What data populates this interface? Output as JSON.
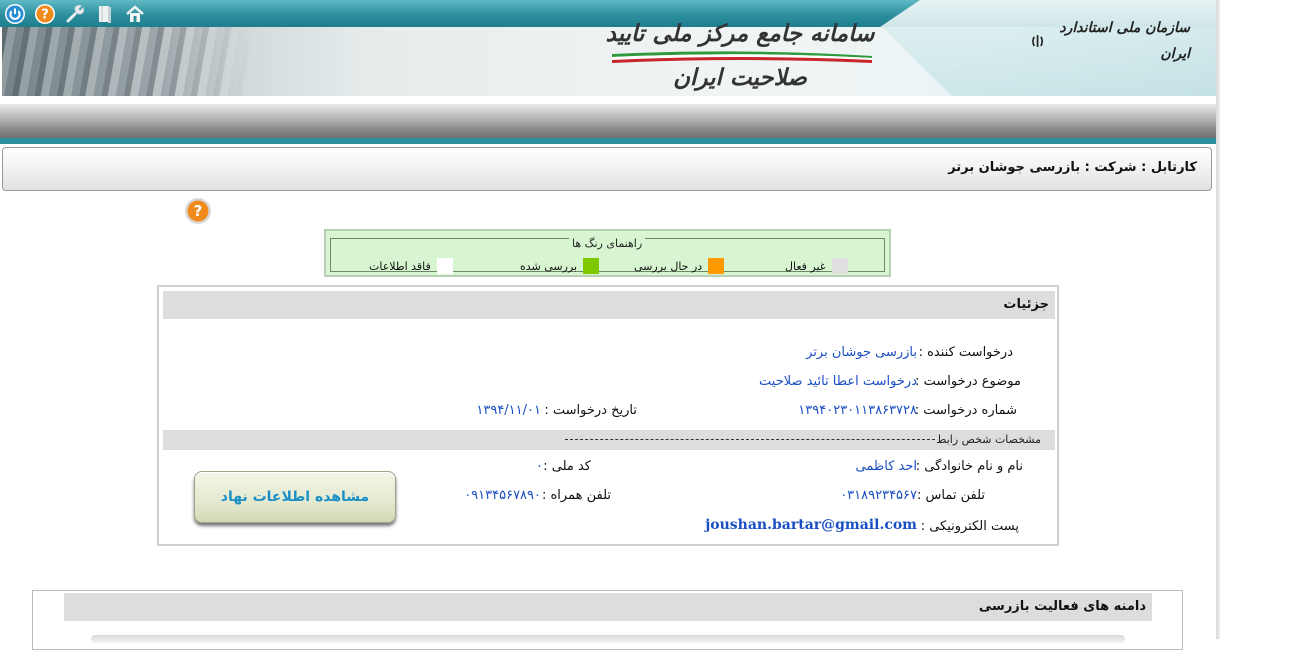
{
  "header": {
    "system_title": "سامانه جامع مرکز ملی تایید صلاحیت ایران",
    "organization": "سازمان ملی استاندارد ایران",
    "icons": [
      "power-icon",
      "help-icon",
      "wrench-icon",
      "book-icon",
      "home-icon"
    ]
  },
  "breadcrumb": {
    "text": "کارتابل : شرکت : بازرسی جوشان برتر"
  },
  "legend": {
    "title": "راهنمای رنگ ها",
    "items": [
      {
        "label": "غیر فعال",
        "color": "#e0e0e0"
      },
      {
        "label": "در حال بررسی",
        "color": "#ff9900"
      },
      {
        "label": "بررسی شده",
        "color": "#7ec800"
      },
      {
        "label": "فاقد اطلاعات",
        "color": "#ffffff"
      }
    ]
  },
  "details": {
    "title": "جزئیات",
    "requester_label": "درخواست کننده :",
    "requester_value": "بازرسی جوشان برتر",
    "subject_label": "موضوع درخواست :",
    "subject_value": "درخواست اعطا تائید صلاحیت",
    "request_number_label": "شماره درخواست :",
    "request_number_value": "۱۳۹۴۰۲۳۰۱۱۳۸۶۳۷۲۸",
    "request_date_label": "تاریخ درخواست :",
    "request_date_value": "۱۳۹۴/۱۱/۰۱",
    "contact_section_title": "مشخصات شخص رابط",
    "name_label": "نام و نام خانوادگی :",
    "name_value": "احد کاظمی",
    "national_code_label": "کد ملی :",
    "national_code_value": "۰",
    "phone_label": "تلفن تماس :",
    "phone_value": "۰۳۱۸۹۲۳۴۵۶۷",
    "mobile_label": "تلفن همراه :",
    "mobile_value": "۰۹۱۳۴۵۶۷۸۹۰",
    "email_label": "پست الکترونیکی :",
    "email_value": "joushan.bartar@gmail.com",
    "institute_button": "مشاهده اطلاعات نهاد"
  },
  "scope": {
    "title": "دامنه های فعالیت بازرسی"
  }
}
